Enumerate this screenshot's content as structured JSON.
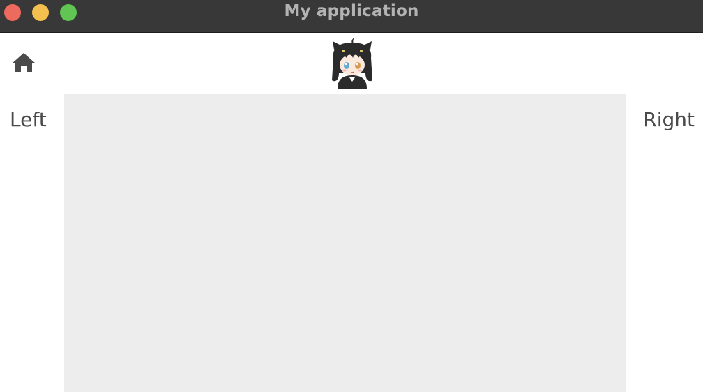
{
  "window": {
    "title": "My application",
    "buttons": [
      {
        "name": "close",
        "color": "#ec6a5e"
      },
      {
        "name": "minimize",
        "color": "#f4bf4f"
      },
      {
        "name": "maximize",
        "color": "#61c554"
      }
    ]
  },
  "toolbar": {
    "home_icon": "home-icon",
    "avatar_icon": "anime-girl-avatar"
  },
  "nav": {
    "left_label": "Left",
    "right_label": "Right"
  },
  "colors": {
    "titlebar": "#383838",
    "title_text": "#b3b3b3",
    "icon": "#4a4a4a",
    "panel": "#ededed",
    "background": "#ffffff"
  }
}
